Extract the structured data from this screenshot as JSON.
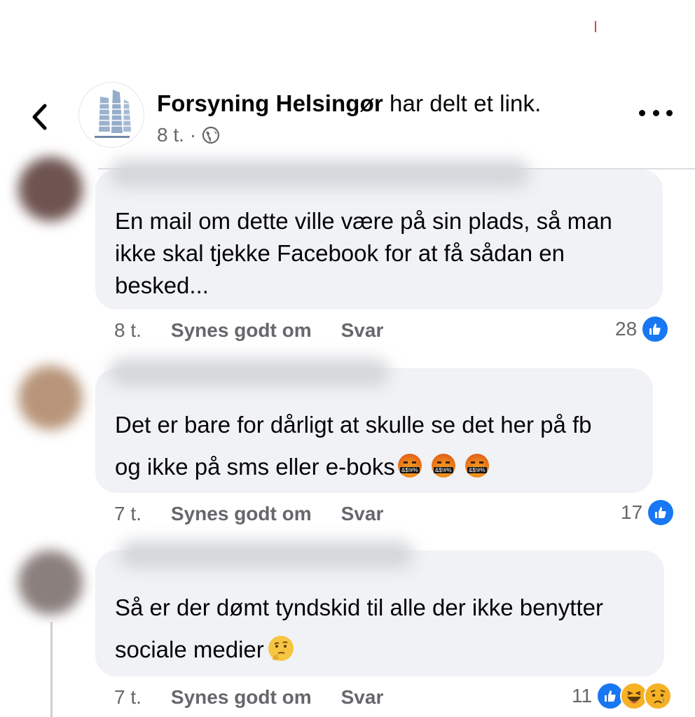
{
  "header": {
    "page_name": "Forsyning Helsingør",
    "action_text": " har delt et link.",
    "time": "8 t.",
    "separator": "·",
    "icons": {
      "back": "chevron-left-icon",
      "audience": "globe-icon",
      "more": "more-options-icon"
    }
  },
  "comments": [
    {
      "text_lines": [
        "En mail om dette ville være på sin plads, så man",
        "ikke skal tjekke Facebook for at få sådan en",
        "besked..."
      ],
      "time": "8 t.",
      "like_label": "Synes godt om",
      "reply_label": "Svar",
      "reaction_count": "28",
      "reactions": [
        "like"
      ]
    },
    {
      "text_lines": [
        "Det er bare for dårligt at skulle se det her på fb",
        "og ikke på sms eller e-boks"
      ],
      "emojis": [
        "angry-cursing-emoji",
        "angry-cursing-emoji",
        "angry-cursing-emoji"
      ],
      "emoji_symbol": "&$!#%",
      "time": "7 t.",
      "like_label": "Synes godt om",
      "reply_label": "Svar",
      "reaction_count": "17",
      "reactions": [
        "like"
      ]
    },
    {
      "text_lines": [
        "Så er der dømt tyndskid til alle der ikke benytter",
        "sociale medier"
      ],
      "emojis": [
        "thinking-face-emoji"
      ],
      "time": "7 t.",
      "like_label": "Synes godt om",
      "reply_label": "Svar",
      "reaction_count": "11",
      "reactions": [
        "like",
        "haha",
        "sad"
      ]
    }
  ],
  "colors": {
    "like_blue": "#1877f2",
    "bubble": "#f0f2f5",
    "secondary_text": "#65676b"
  }
}
